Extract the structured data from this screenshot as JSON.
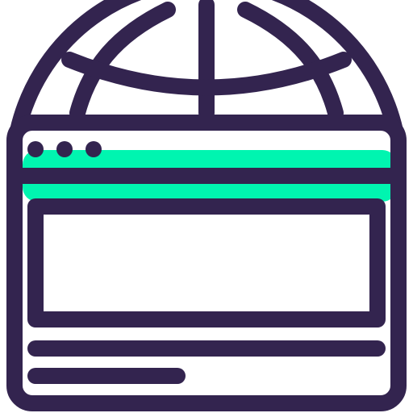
{
  "icon": {
    "name": "web-browser-globe-icon",
    "colors": {
      "outline": "#33244f",
      "accent": "#00f5b0",
      "background": "#ffffff"
    },
    "parts": [
      "globe-icon",
      "browser-window",
      "window-dots",
      "title-bar",
      "content-panel",
      "text-lines"
    ]
  }
}
